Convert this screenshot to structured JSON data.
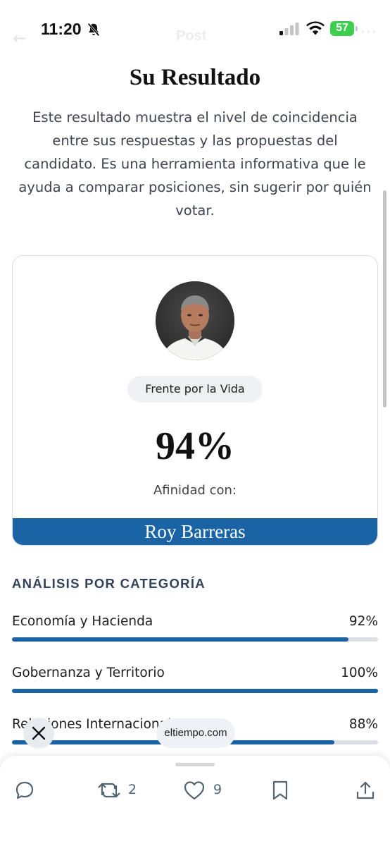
{
  "status_bar": {
    "time": "11:20",
    "battery": "57",
    "colors": {
      "battery": "#3ccf4e"
    }
  },
  "ghost_header": {
    "title": "Post"
  },
  "result": {
    "title": "Su Resultado",
    "description": "Este resultado muestra el nivel de coincidencia entre sus respuestas y las propuestas del candidato. Es una herramienta informativa que le ayuda a comparar posiciones, sin sugerir por quién votar.",
    "party": "Frente por la Vida",
    "percentage": "94%",
    "affinity_label": "Afinidad con:",
    "candidate_name": "Roy Barreras",
    "accent_color": "#1a64a6"
  },
  "categories": {
    "heading": "ANÁLISIS POR CATEGORÍA",
    "items": [
      {
        "label": "Economía y Hacienda",
        "value": "92%",
        "fraction": 0.92
      },
      {
        "label": "Gobernanza y Territorio",
        "value": "100%",
        "fraction": 1.0
      },
      {
        "label": "Relaciones Internacionales",
        "value": "88%",
        "fraction": 0.88
      }
    ]
  },
  "overlay": {
    "close_icon": "close-icon",
    "source": "eltiempo.com"
  },
  "actions": {
    "reply_icon": "reply-icon",
    "repost_icon": "repost-icon",
    "repost_count": "2",
    "like_icon": "heart-icon",
    "like_count": "9",
    "bookmark_icon": "bookmark-icon",
    "share_icon": "share-icon"
  }
}
